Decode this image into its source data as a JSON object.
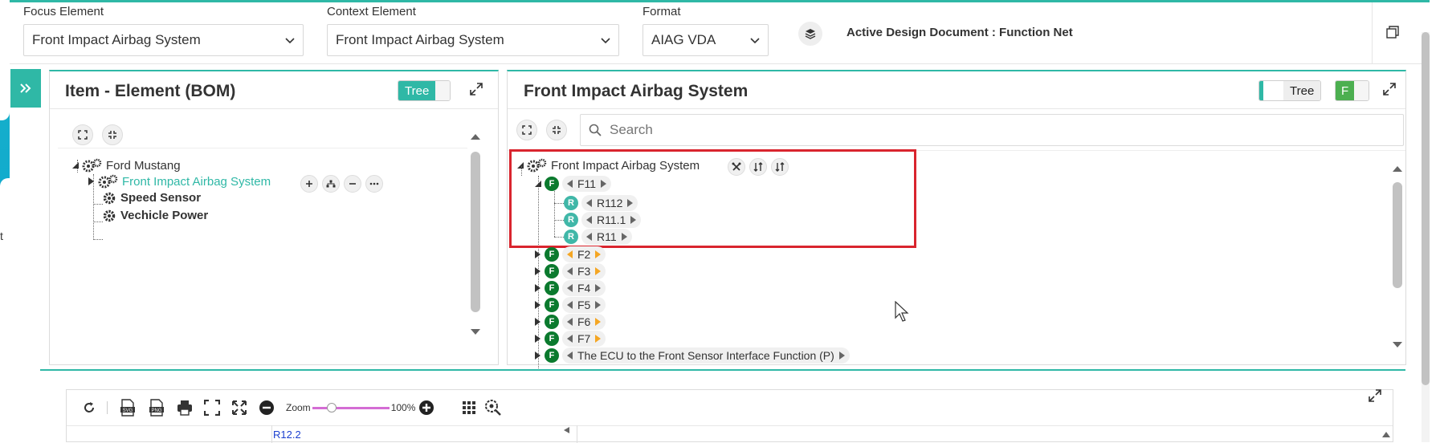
{
  "header": {
    "focus_label": "Focus Element",
    "focus_value": "Front Impact Airbag System",
    "context_label": "Context Element",
    "context_value": "Front Impact Airbag System",
    "format_label": "Format",
    "format_value": "AIAG VDA",
    "active_doc": "Active Design Document : Function Net"
  },
  "left_strip_letter": "t",
  "bom_panel": {
    "title": "Item - Element (BOM)",
    "toggle_label": "Tree",
    "tree": [
      {
        "label": "Ford Mustang"
      },
      {
        "label": "Front Impact Airbag System",
        "selected": true
      },
      {
        "label": "Speed Sensor"
      },
      {
        "label": "Vechicle Power"
      }
    ]
  },
  "fn_panel": {
    "title": "Front Impact Airbag System",
    "toggle_label": "Tree",
    "f_toggle": "F",
    "search_placeholder": "Search",
    "root_label": "Front Impact Airbag System",
    "badge_f": "F",
    "badge_r": "R",
    "functions": [
      {
        "label": "F11",
        "children": [
          "R112",
          "R11.1",
          "R11"
        ]
      },
      {
        "label": "F2"
      },
      {
        "label": "F3"
      },
      {
        "label": "F4"
      },
      {
        "label": "F5"
      },
      {
        "label": "F6"
      },
      {
        "label": "F7"
      },
      {
        "label": "The ECU to the Front Sensor Interface Function (P)"
      }
    ]
  },
  "bottom": {
    "zoom_label": "Zoom",
    "zoom_value": "100%",
    "zoom_fraction": 0.22,
    "cell_text": "R12.2",
    "svg_label": "SVG",
    "png_label": "PNG"
  },
  "colors": {
    "accent": "#2fb8a6",
    "function_badge": "#0b7a2e",
    "requirement_badge": "#40b7a8",
    "highlight": "#d9252e",
    "zoom_slider": "#d46cd4"
  }
}
